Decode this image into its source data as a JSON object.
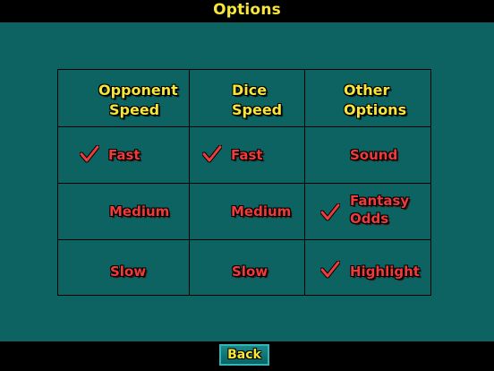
{
  "window": {
    "title": "Options"
  },
  "table": {
    "headers": [
      {
        "line1": "Opponent",
        "line2": "Speed"
      },
      {
        "line1": "Dice",
        "line2": "Speed"
      },
      {
        "line1": "Other",
        "line2": "Options"
      }
    ],
    "opponent_speed": {
      "fast": {
        "label": "Fast",
        "checked": true
      },
      "medium": {
        "label": "Medium",
        "checked": false
      },
      "slow": {
        "label": "Slow",
        "checked": false
      }
    },
    "dice_speed": {
      "fast": {
        "label": "Fast",
        "checked": true
      },
      "medium": {
        "label": "Medium",
        "checked": false
      },
      "slow": {
        "label": "Slow",
        "checked": false
      }
    },
    "other_options": {
      "sound": {
        "label": "Sound",
        "checked": false
      },
      "fantasy_odds": {
        "line1": "Fantasy",
        "line2": "Odds",
        "checked": true
      },
      "highlight": {
        "label": "Highlight",
        "checked": true
      }
    }
  },
  "footer": {
    "back_label": "Back"
  },
  "colors": {
    "background": "#0d6262",
    "header_text": "#f6e63a",
    "option_text": "#ee3b3b",
    "check": "#ee3b3b"
  },
  "icons": {
    "check": "checkmark-icon"
  }
}
